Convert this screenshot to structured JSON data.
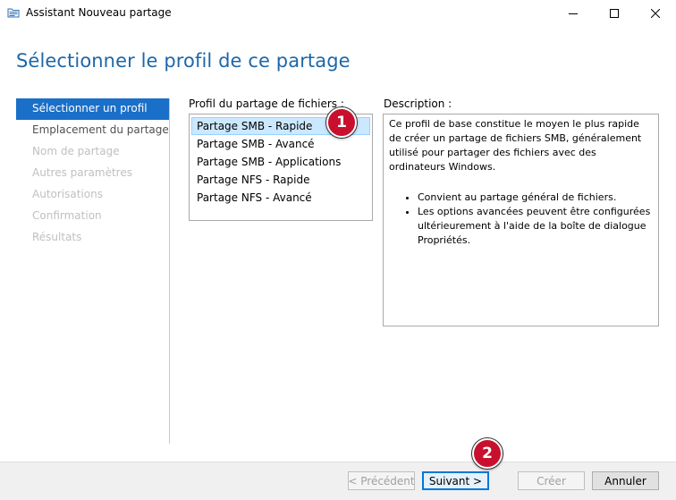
{
  "window": {
    "title": "Assistant Nouveau partage",
    "icon": "share-folder-icon",
    "controls": [
      "minimize-icon",
      "maximize-icon",
      "close-icon"
    ]
  },
  "page_title": "Sélectionner le profil de ce partage",
  "nav": {
    "items": [
      {
        "label": "Sélectionner un profil",
        "state": "active"
      },
      {
        "label": "Emplacement du partage",
        "state": "enabled"
      },
      {
        "label": "Nom de partage",
        "state": "disabled"
      },
      {
        "label": "Autres paramètres",
        "state": "disabled"
      },
      {
        "label": "Autorisations",
        "state": "disabled"
      },
      {
        "label": "Confirmation",
        "state": "disabled"
      },
      {
        "label": "Résultats",
        "state": "disabled"
      }
    ]
  },
  "profiles": {
    "label": "Profil du partage de fichiers :",
    "items": [
      "Partage SMB - Rapide",
      "Partage SMB - Avancé",
      "Partage SMB - Applications",
      "Partage NFS - Rapide",
      "Partage NFS - Avancé"
    ],
    "selected": "Partage SMB - Rapide"
  },
  "description": {
    "label": "Description :",
    "text": "Ce profil de base constitue le moyen le plus rapide de créer un partage de fichiers SMB, généralement utilisé pour partager des fichiers avec des ordinateurs Windows.",
    "bullets": [
      "Convient au partage général de fichiers.",
      "Les options avancées peuvent être configurées ultérieurement à l'aide de la boîte de dialogue Propriétés."
    ]
  },
  "buttons": {
    "previous": "< Précédent",
    "next": "Suivant >",
    "create": "Créer",
    "cancel": "Annuler"
  },
  "markers": [
    "1",
    "2"
  ],
  "colors": {
    "title_blue": "#1e67a8",
    "nav_active": "#1a6fc9",
    "selection": "#cce8ff",
    "marker_red": "#c8102e"
  }
}
